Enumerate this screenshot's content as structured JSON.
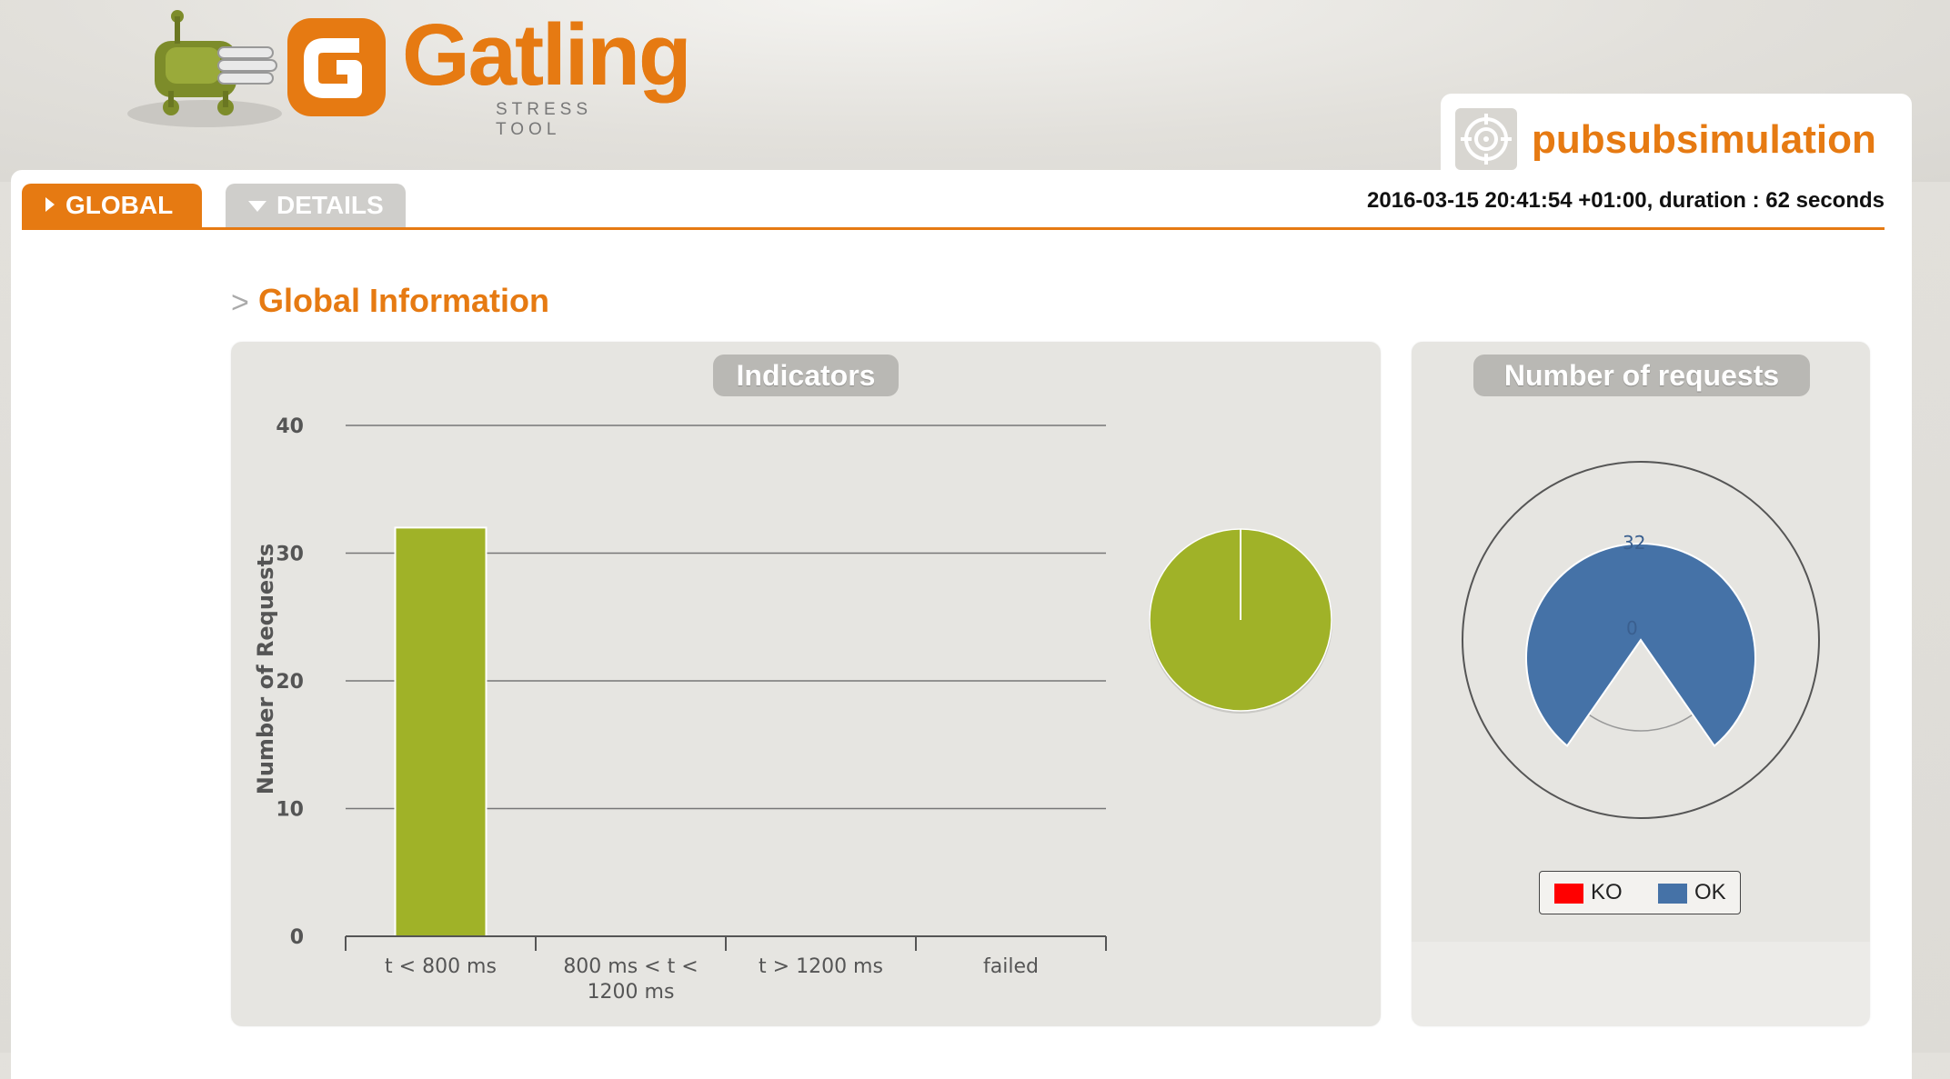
{
  "brand": {
    "name": "Gatling",
    "tagline": "STRESS TOOL",
    "accent_color": "#e67a12"
  },
  "simulation": {
    "name": "pubsubsimulation",
    "icon": "target-icon",
    "run_info": "2016-03-15 20:41:54 +01:00, duration : 62 seconds"
  },
  "tabs": [
    {
      "label": "GLOBAL",
      "active": true,
      "icon": "triangle-right-icon"
    },
    {
      "label": "DETAILS",
      "active": false,
      "icon": "triangle-down-icon"
    }
  ],
  "section": {
    "arrow": ">",
    "title": "Global Information"
  },
  "indicators": {
    "title": "Indicators"
  },
  "requests": {
    "title": "Number of requests",
    "legend": [
      {
        "label": "KO",
        "color": "#ff0000"
      },
      {
        "label": "OK",
        "color": "#4572a7"
      }
    ],
    "inner_labels": [
      "32",
      "0"
    ]
  },
  "chart_data": [
    {
      "type": "bar",
      "title": "Indicators",
      "ylabel": "Number of Requests",
      "ylim": [
        0,
        40
      ],
      "yticks": [
        "0",
        "10",
        "20",
        "30",
        "40"
      ],
      "categories": [
        "t < 800 ms",
        "800 ms < t < 1200 ms",
        "t > 1200 ms",
        "failed"
      ],
      "category_lines": [
        [
          "t < 800 ms"
        ],
        [
          "800 ms < t <",
          "1200 ms"
        ],
        [
          "t > 1200 ms"
        ],
        [
          "failed"
        ]
      ],
      "values": [
        32,
        0,
        0,
        0
      ],
      "colors": [
        "#a0b228",
        "#f7a35c",
        "#e5262c",
        "#ff0000"
      ],
      "grid": true
    },
    {
      "type": "pie",
      "slices": [
        {
          "label": "t < 800 ms",
          "value": 32,
          "color": "#a0b228"
        },
        {
          "label": "800 ms < t < 1200 ms",
          "value": 0,
          "color": "#f7a35c"
        },
        {
          "label": "t > 1200 ms",
          "value": 0,
          "color": "#e5262c"
        },
        {
          "label": "failed",
          "value": 0,
          "color": "#ff0000"
        }
      ]
    },
    {
      "type": "pie",
      "title": "Number of requests",
      "slices": [
        {
          "label": "OK",
          "value": 32,
          "color": "#4572a7"
        },
        {
          "label": "KO",
          "value": 0,
          "color": "#ff0000"
        }
      ],
      "legend": "bottom"
    }
  ]
}
